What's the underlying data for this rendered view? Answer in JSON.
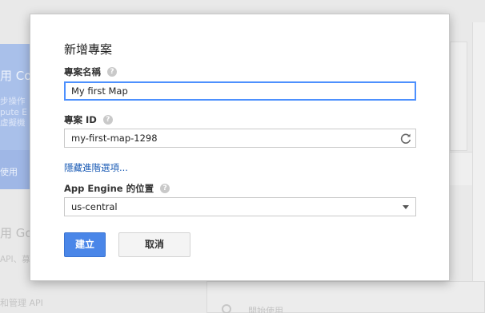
{
  "background": {
    "left_card_title": "用 Con",
    "left_card_desc": [
      "步操作",
      "pute E",
      "虛擬機"
    ],
    "left_card_use": "使用",
    "left_google": "用 Goo",
    "left_api": "API、募",
    "left_manage": "和管理 API",
    "bottom_label": "開始使用"
  },
  "dialog": {
    "title": "新增專案",
    "project_name": {
      "label": "專案名稱",
      "value": "My first Map"
    },
    "project_id": {
      "label": "專案 ID",
      "value": "my-first-map-1298"
    },
    "advanced_link": "隱藏進階選項...",
    "app_engine_location": {
      "label": "App Engine 的位置",
      "selected": "us-central"
    },
    "create_button": "建立",
    "cancel_button": "取消",
    "help_glyph": "?"
  },
  "colors": {
    "primary": "#4a86e8",
    "link": "#1a5bb5",
    "focus": "#4d90fe"
  },
  "icons": {
    "help": "help-icon",
    "refresh": "refresh-icon",
    "dropdown": "chevron-down-icon"
  }
}
